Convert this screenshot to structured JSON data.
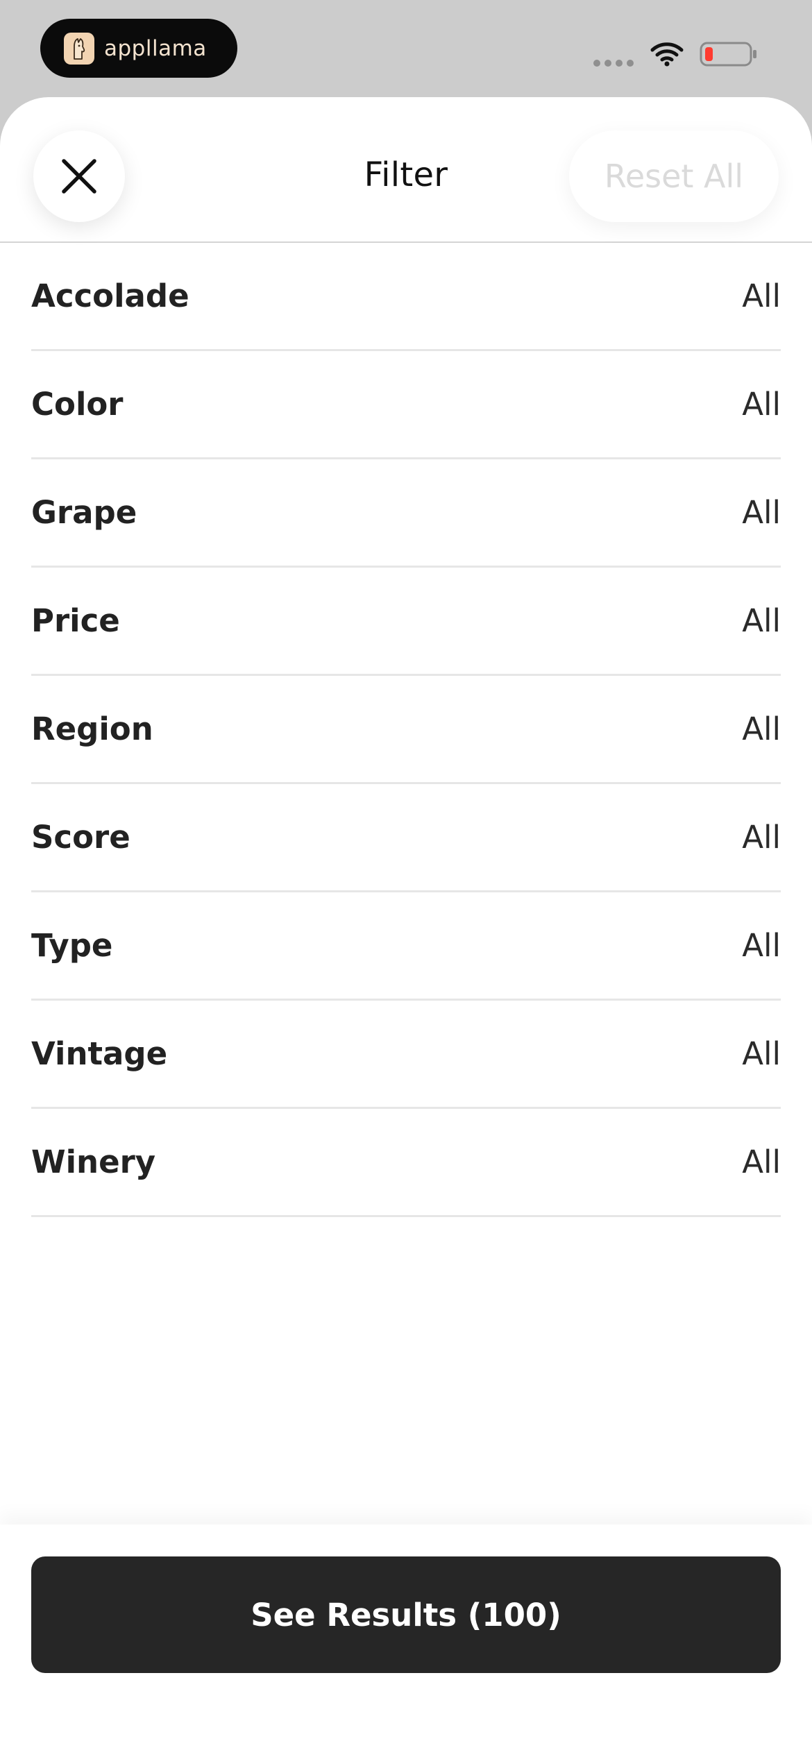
{
  "status_bar": {
    "app_name": "appllama",
    "icons": [
      "app-logo-icon",
      "cellular-signal-icon",
      "wifi-icon",
      "battery-low-icon"
    ],
    "battery_level_color": "#ff3b30"
  },
  "header": {
    "title": "Filter",
    "reset_label": "Reset All",
    "close_icon": "close-icon"
  },
  "filters": [
    {
      "label": "Accolade",
      "value": "All"
    },
    {
      "label": "Color",
      "value": "All"
    },
    {
      "label": "Grape",
      "value": "All"
    },
    {
      "label": "Price",
      "value": "All"
    },
    {
      "label": "Region",
      "value": "All"
    },
    {
      "label": "Score",
      "value": "All"
    },
    {
      "label": "Type",
      "value": "All"
    },
    {
      "label": "Vintage",
      "value": "All"
    },
    {
      "label": "Winery",
      "value": "All"
    }
  ],
  "footer": {
    "see_results_label": "See Results (100)"
  },
  "colors": {
    "primary_button": "#262626",
    "disabled_text": "#dadada",
    "status_background": "#cccccc"
  }
}
